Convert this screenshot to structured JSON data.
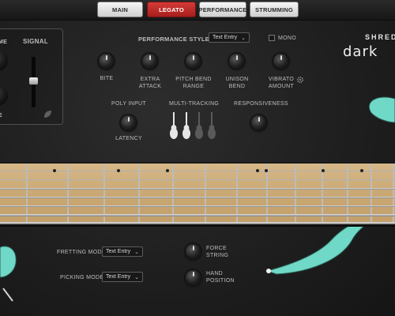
{
  "tabs": [
    {
      "label": "MAIN",
      "active": false
    },
    {
      "label": "LEGATO",
      "active": true
    },
    {
      "label": "PERFORMANCE",
      "active": false
    },
    {
      "label": "STRUMMING",
      "active": false
    }
  ],
  "signal_panel": {
    "title": "SIGNAL",
    "left_label_top": "ME",
    "left_label_bottom": "E",
    "icon": "leaf-icon"
  },
  "performance": {
    "style_label": "PERFORMANCE STYLE",
    "style_value": "Text Entry",
    "mono_label": "MONO",
    "knobs": [
      "BITE",
      "EXTRA ATTACK",
      "PITCH BEND RANGE",
      "UNISON BEND",
      "VIBRATO AMOUNT"
    ],
    "gear_icon": "gear-icon"
  },
  "lower": {
    "poly_input_label": "POLY INPUT",
    "latency_label": "LATENCY",
    "multitracking_label": "MULTI-TRACKING",
    "responsiveness_label": "RESPONSIVENESS"
  },
  "bottom": {
    "fretting_mode_label": "FRETTING MODE",
    "fretting_mode_value": "Text Entry",
    "picking_mode_label": "PICKING MODE",
    "picking_mode_value": "Text Entry",
    "force_string_label": "FORCE STRING",
    "hand_position_label": "HAND POSITION"
  },
  "brand": {
    "line1": "SHRED",
    "line2": "dark"
  },
  "colors": {
    "accent_red": "#c32b29",
    "guitar_teal": "#6fd8c6"
  }
}
